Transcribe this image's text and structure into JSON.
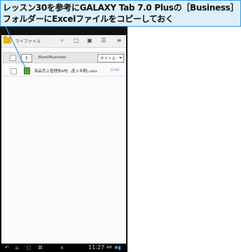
{
  "callout": {
    "text": "レッスン30を参考にGALAXY Tab 7.0 Plusの［Business］\nフォルダーにExcelファイルをコピーしておく"
  },
  "app_bar": {
    "title": "マイファイル",
    "icons": [
      "search-icon",
      "new-folder-icon",
      "upload-folder-icon",
      "list-view-icon",
      "menu-icon"
    ]
  },
  "path_row": {
    "path": "/Root/Business",
    "up_button": "t",
    "sort_label": "タイトル"
  },
  "files": [
    {
      "name": "商品売上管理表A地...度上半期).xlsx",
      "size": "13 KB"
    }
  ],
  "nav_bar": {
    "time": "11:27",
    "ampm": "AM",
    "status": "✱▮"
  },
  "colors": {
    "callout_bg": "#dcf0fb",
    "callout_border": "#3a9ad9",
    "excel_icon": "#5aa03c",
    "file_size": "#3a7bd5"
  }
}
